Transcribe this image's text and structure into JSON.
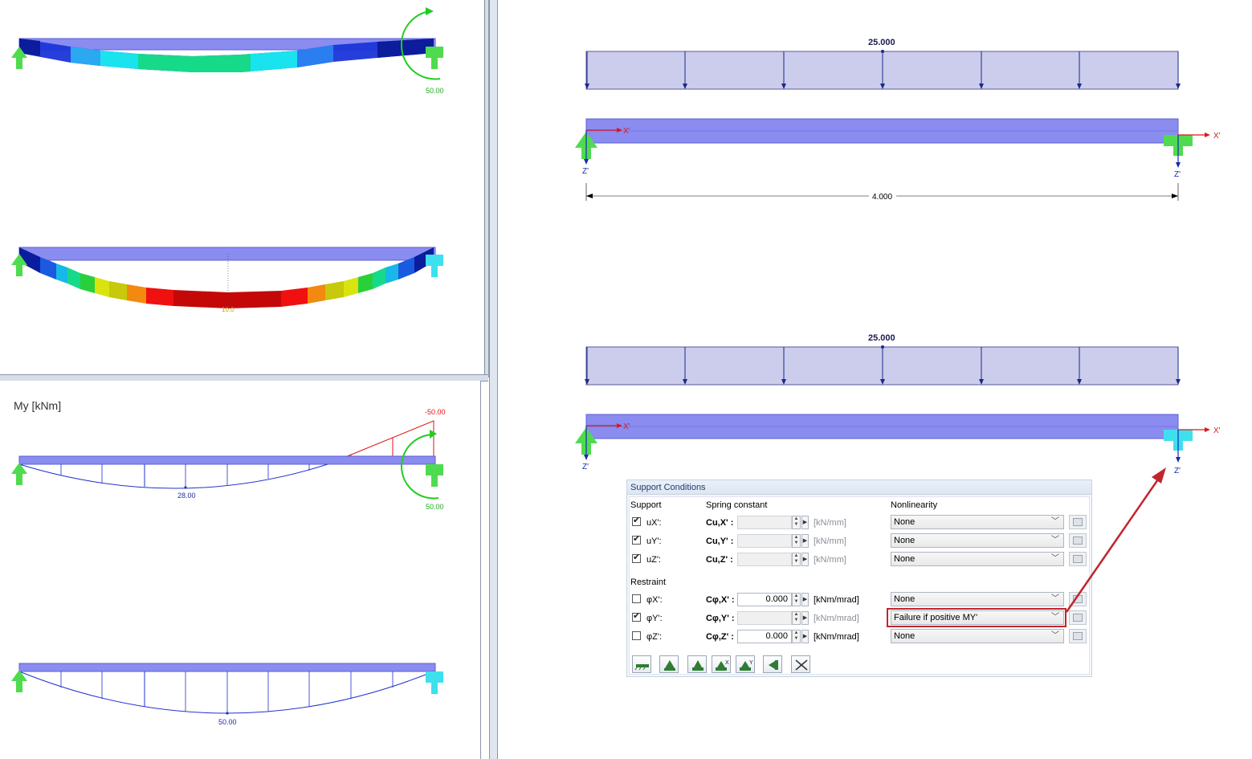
{
  "left_top_panel": {
    "deformed_beam_value": "50.00",
    "stress_beam_value": "10.0"
  },
  "left_bottom_panel": {
    "title": "My [kNm]",
    "moment_beam_1": {
      "end_moment": "-50.00",
      "mid_moment": "28.00",
      "reaction": "50.00"
    },
    "moment_beam_2": {
      "mid_moment": "50.00"
    }
  },
  "right_panel": {
    "beam_1": {
      "load_value": "25.000",
      "span_dimension": "4.000",
      "axis_x": "X'",
      "axis_z": "Z'"
    },
    "beam_2": {
      "load_value": "25.000",
      "axis_x": "X'",
      "axis_z": "Z'"
    }
  },
  "support_dialog": {
    "title": "Support Conditions",
    "col_support": "Support",
    "col_spring": "Spring constant",
    "col_nonlinearity": "Nonlinearity",
    "section_restraint": "Restraint",
    "support_rows": [
      {
        "label": "uX':",
        "checked": true,
        "const_label": "Cu,X' :",
        "value": "",
        "unit": "[kN/mm]",
        "enabled": false,
        "nonlinearity": "None"
      },
      {
        "label": "uY':",
        "checked": true,
        "const_label": "Cu,Y' :",
        "value": "",
        "unit": "[kN/mm]",
        "enabled": false,
        "nonlinearity": "None"
      },
      {
        "label": "uZ':",
        "checked": true,
        "const_label": "Cu,Z' :",
        "value": "",
        "unit": "[kN/mm]",
        "enabled": false,
        "nonlinearity": "None"
      }
    ],
    "restraint_rows": [
      {
        "label": "φX':",
        "checked": false,
        "const_label": "Cφ,X' :",
        "value": "0.000",
        "unit": "[kNm/mrad]",
        "enabled": true,
        "nonlinearity": "None"
      },
      {
        "label": "φY':",
        "checked": true,
        "const_label": "Cφ,Y' :",
        "value": "",
        "unit": "[kNm/mrad]",
        "enabled": false,
        "nonlinearity": "Failure if positive MY'"
      },
      {
        "label": "φZ':",
        "checked": false,
        "const_label": "Cφ,Z' :",
        "value": "0.000",
        "unit": "[kNm/mrad]",
        "enabled": true,
        "nonlinearity": "None"
      }
    ],
    "highlight_color": "#c0272d"
  }
}
